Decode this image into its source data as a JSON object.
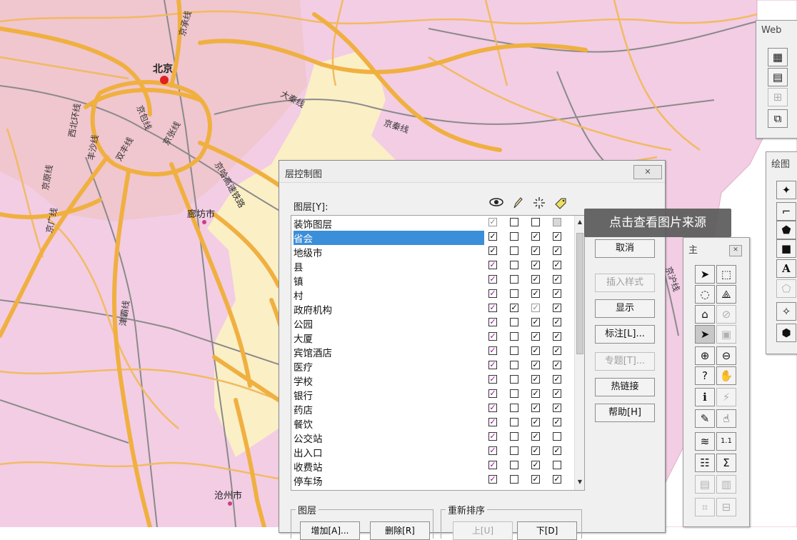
{
  "map": {
    "cities": [
      {
        "label": "北京"
      },
      {
        "label": "廊坊市"
      },
      {
        "label": "沧州市"
      }
    ],
    "roads": [
      "京承线",
      "大秦线",
      "京秦线",
      "西北环线",
      "京包线",
      "京张线",
      "丰沙线",
      "双丰线",
      "京原线",
      "京广线",
      "京哈高速铁路",
      "津霸线",
      "京沪线"
    ]
  },
  "tooltip": {
    "text": "点击查看图片来源"
  },
  "layer_dialog": {
    "title": "层控制图",
    "close_label": "✕",
    "layers_label": "图层[Y]:",
    "layers": [
      {
        "name": "装饰图层",
        "visible": "gray",
        "edit": false,
        "select": false,
        "label": "grayfill"
      },
      {
        "name": "省会",
        "visible": true,
        "edit": false,
        "select": true,
        "label": true,
        "selected": true
      },
      {
        "name": "地级市",
        "visible": true,
        "edit": false,
        "select": true,
        "label": true
      },
      {
        "name": "县",
        "visible": "purple",
        "edit": false,
        "select": true,
        "label": true
      },
      {
        "name": "镇",
        "visible": "purple",
        "edit": false,
        "select": true,
        "label": true
      },
      {
        "name": "村",
        "visible": "purple",
        "edit": false,
        "select": true,
        "label": true
      },
      {
        "name": "政府机构",
        "visible": "purple",
        "edit": true,
        "select": "gray",
        "label": true
      },
      {
        "name": "公园",
        "visible": "purple",
        "edit": false,
        "select": true,
        "label": true
      },
      {
        "name": "大厦",
        "visible": "purple",
        "edit": false,
        "select": true,
        "label": true
      },
      {
        "name": "宾馆酒店",
        "visible": "purple",
        "edit": false,
        "select": true,
        "label": true
      },
      {
        "name": "医疗",
        "visible": "purple",
        "edit": false,
        "select": true,
        "label": true
      },
      {
        "name": "学校",
        "visible": "purple",
        "edit": false,
        "select": true,
        "label": true
      },
      {
        "name": "银行",
        "visible": "purple",
        "edit": false,
        "select": true,
        "label": true
      },
      {
        "name": "药店",
        "visible": "purple",
        "edit": false,
        "select": true,
        "label": true
      },
      {
        "name": "餐饮",
        "visible": "purple",
        "edit": false,
        "select": true,
        "label": true
      },
      {
        "name": "公交站",
        "visible": "purple",
        "edit": false,
        "select": true,
        "label": false
      },
      {
        "name": "出入口",
        "visible": "purple",
        "edit": false,
        "select": true,
        "label": true
      },
      {
        "name": "收费站",
        "visible": "purple",
        "edit": false,
        "select": true,
        "label": false
      },
      {
        "name": "停车场",
        "visible": "purple",
        "edit": false,
        "select": true,
        "label": true
      }
    ],
    "buttons": [
      {
        "label": "取消",
        "disabled": false
      },
      {
        "label": "插入样式",
        "disabled": true
      },
      {
        "label": "显示",
        "disabled": false
      },
      {
        "label": "标注[L]...",
        "disabled": false
      },
      {
        "label": "专题[T]...",
        "disabled": true
      },
      {
        "label": "热链接",
        "disabled": false
      },
      {
        "label": "帮助[H]",
        "disabled": false
      }
    ],
    "group_layer": {
      "legend": "图层",
      "add": "增加[A]...",
      "delete": "删除[R]"
    },
    "group_reorder": {
      "legend": "重新排序",
      "up": "上[U]",
      "down": "下[D]"
    }
  },
  "web_palette": {
    "title": "Web"
  },
  "draw_palette": {
    "title": "绘图"
  },
  "main_palette": {
    "title": "主",
    "close_label": "✕"
  }
}
